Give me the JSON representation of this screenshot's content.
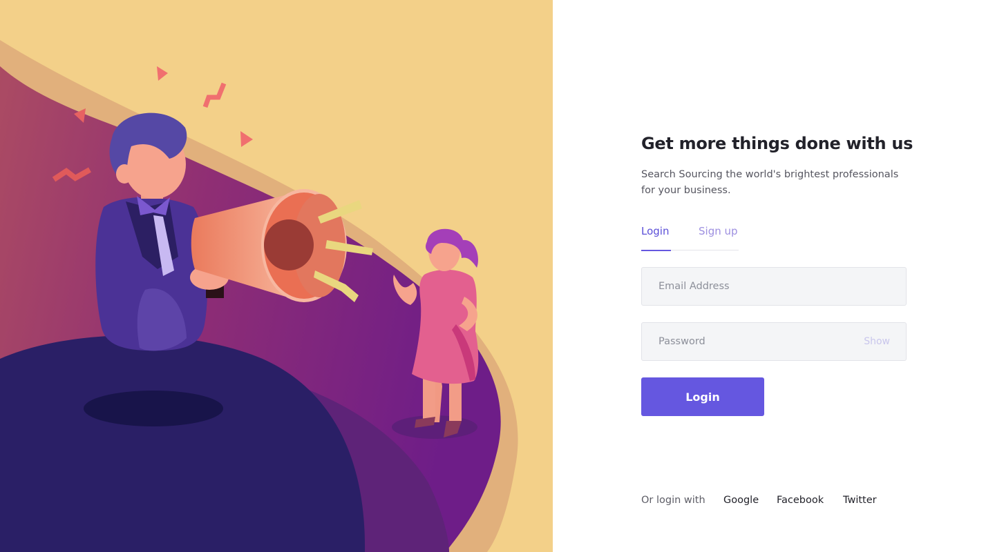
{
  "colors": {
    "accent": "#6557e0",
    "tab_active": "#5b4fd8",
    "tab_inactive": "#9d8fe0",
    "illustration_background": "#f3d089"
  },
  "illustration": {
    "icon": "megaphone-announcement-illustration"
  },
  "header": {
    "title": "Get more things done with us",
    "subtitle": "Search Sourcing the world's brightest professionals for your business."
  },
  "tabs": [
    {
      "label": "Login",
      "active": true
    },
    {
      "label": "Sign up",
      "active": false
    }
  ],
  "form": {
    "email": {
      "placeholder": "Email Address",
      "value": ""
    },
    "password": {
      "placeholder": "Password",
      "value": "",
      "toggle_label": "Show"
    },
    "submit_label": "Login"
  },
  "social": {
    "label": "Or login with",
    "providers": [
      "Google",
      "Facebook",
      "Twitter"
    ]
  }
}
